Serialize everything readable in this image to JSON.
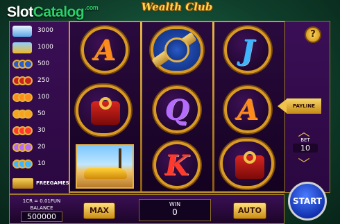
{
  "watermark": {
    "brand_a": "Slot",
    "brand_b": "Catalog",
    "suffix": ".com"
  },
  "game_title": "Wealth Club",
  "paytable": [
    {
      "symbol": "yacht",
      "payout": "3000"
    },
    {
      "symbol": "car",
      "payout": "1000"
    },
    {
      "symbol": "watch",
      "payout": "500"
    },
    {
      "symbol": "ring",
      "payout": "250"
    },
    {
      "symbol": "A",
      "payout": "100"
    },
    {
      "symbol": "J",
      "payout": "50"
    },
    {
      "symbol": "K",
      "payout": "30"
    },
    {
      "symbol": "Q",
      "payout": "20"
    },
    {
      "symbol": "J-blue",
      "payout": "10"
    }
  ],
  "freegames_label": "FREEGAMES",
  "reels": [
    [
      "A",
      "ring",
      "car"
    ],
    [
      "watch",
      "Q",
      "K"
    ],
    [
      "J",
      "A",
      "ring"
    ]
  ],
  "controls": {
    "help": "?",
    "payline": "PAYLINE",
    "bet_label": "BET",
    "bet_value": "10",
    "start": "START",
    "max": "MAX",
    "auto": "AUTO"
  },
  "footer": {
    "rate": "1CR = 0.01FUN",
    "balance_label": "BALANCE",
    "balance_value": "500000",
    "win_label": "WIN",
    "win_value": "0"
  },
  "colors": {
    "gold": "#d99a25",
    "panel": "#3b0f56",
    "start_blue": "#1233b0"
  }
}
